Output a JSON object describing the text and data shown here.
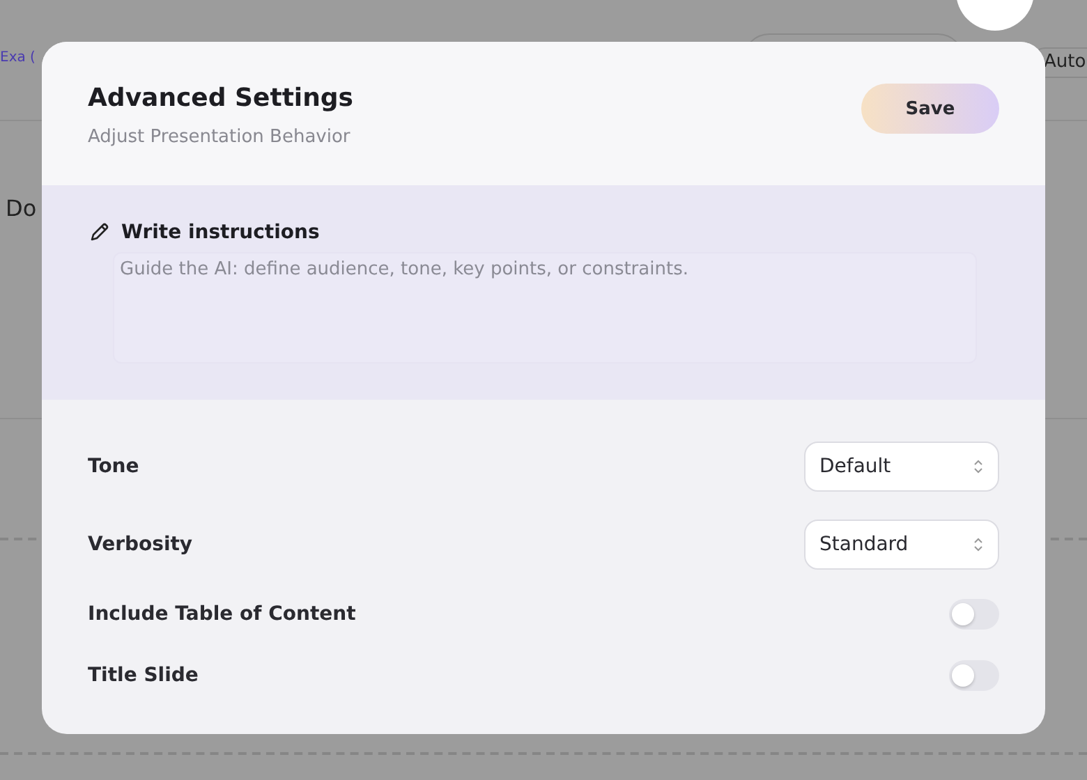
{
  "background": {
    "texts": [
      {
        "kind": "link",
        "text": "Exa ("
      },
      {
        "kind": "button",
        "text": "Auto"
      },
      {
        "kind": "heading",
        "text": "Do"
      }
    ]
  },
  "dialog": {
    "title": "Advanced Settings",
    "subtitle": "Adjust Presentation Behavior",
    "save_button": "Save",
    "instructions": {
      "label": "Write instructions",
      "placeholder": "Guide the AI: define audience, tone, key points, or constraints."
    },
    "settings": [
      {
        "kind": "select",
        "label": "Tone",
        "value": "Default"
      },
      {
        "kind": "select",
        "label": "Verbosity",
        "value": "Standard"
      },
      {
        "kind": "toggle",
        "label": "Include Table of Content",
        "on": false
      },
      {
        "kind": "toggle",
        "label": "Title Slide",
        "on": false
      }
    ]
  }
}
